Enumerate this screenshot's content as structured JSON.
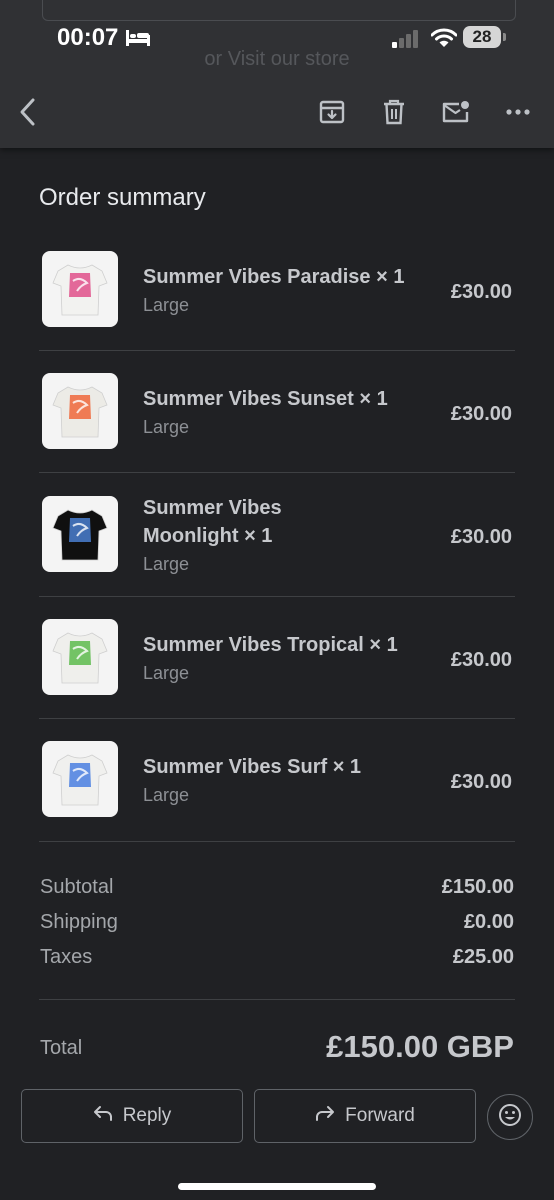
{
  "status_bar": {
    "time": "00:07",
    "battery": "28"
  },
  "background_link": "or Visit our store",
  "order": {
    "title": "Order summary",
    "items": [
      {
        "name": "Summer Vibes Paradise × 1",
        "variant": "Large",
        "price": "£30.00",
        "shirt_color": "#f2f2f0",
        "print_color": "#e0508a"
      },
      {
        "name": "Summer Vibes Sunset × 1",
        "variant": "Large",
        "price": "£30.00",
        "shirt_color": "#ecebe6",
        "print_color": "#f0673a"
      },
      {
        "name": "Summer Vibes Moonlight × 1",
        "variant": "Large",
        "price": "£30.00",
        "shirt_color": "#101010",
        "print_color": "#4a7fd0"
      },
      {
        "name": "Summer Vibes Tropical × 1",
        "variant": "Large",
        "price": "£30.00",
        "shirt_color": "#efefec",
        "print_color": "#5dbb4e"
      },
      {
        "name": "Summer Vibes Surf × 1",
        "variant": "Large",
        "price": "£30.00",
        "shirt_color": "#f0f0ee",
        "print_color": "#4a7fe0"
      }
    ],
    "summary": {
      "subtotal_label": "Subtotal",
      "subtotal": "£150.00",
      "shipping_label": "Shipping",
      "shipping": "£0.00",
      "taxes_label": "Taxes",
      "taxes": "£25.00",
      "total_label": "Total",
      "total": "£150.00 GBP"
    }
  },
  "actions": {
    "reply": "Reply",
    "forward": "Forward"
  },
  "icons": [
    "back-icon",
    "archive-icon",
    "delete-icon",
    "mark-unread-icon",
    "more-icon",
    "reply-icon",
    "forward-icon",
    "emoji-icon"
  ]
}
